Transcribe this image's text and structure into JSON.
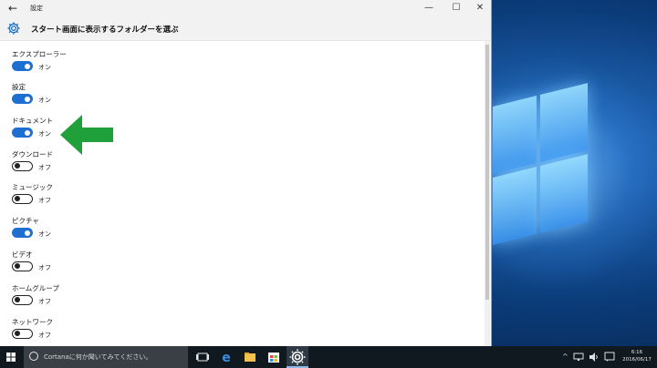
{
  "window": {
    "title": "設定",
    "back_glyph": "←",
    "min_glyph": "—",
    "max_glyph": "☐",
    "close_glyph": "✕"
  },
  "page": {
    "title": "スタート画面に表示するフォルダーを選ぶ"
  },
  "settings": [
    {
      "label": "エクスプローラー",
      "state": "オン",
      "on": true
    },
    {
      "label": "設定",
      "state": "オン",
      "on": true
    },
    {
      "label": "ドキュメント",
      "state": "オン",
      "on": true
    },
    {
      "label": "ダウンロード",
      "state": "オフ",
      "on": false
    },
    {
      "label": "ミュージック",
      "state": "オフ",
      "on": false
    },
    {
      "label": "ピクチャ",
      "state": "オン",
      "on": true
    },
    {
      "label": "ビデオ",
      "state": "オフ",
      "on": false
    },
    {
      "label": "ホームグループ",
      "state": "オフ",
      "on": false
    },
    {
      "label": "ネットワーク",
      "state": "オフ",
      "on": false
    }
  ],
  "colors": {
    "toggle_on": "#1f6fd2",
    "arrow": "#1fa03a",
    "taskbar": "#101820"
  },
  "taskbar": {
    "search_placeholder": "Cortanaに何か聞いてみてください。",
    "icons": [
      "start-icon",
      "task-view-icon",
      "edge-icon",
      "file-explorer-icon",
      "store-icon",
      "settings-icon"
    ],
    "tray_chevron": "^",
    "clock_time": "6:16",
    "clock_date": "2016/06/17"
  }
}
